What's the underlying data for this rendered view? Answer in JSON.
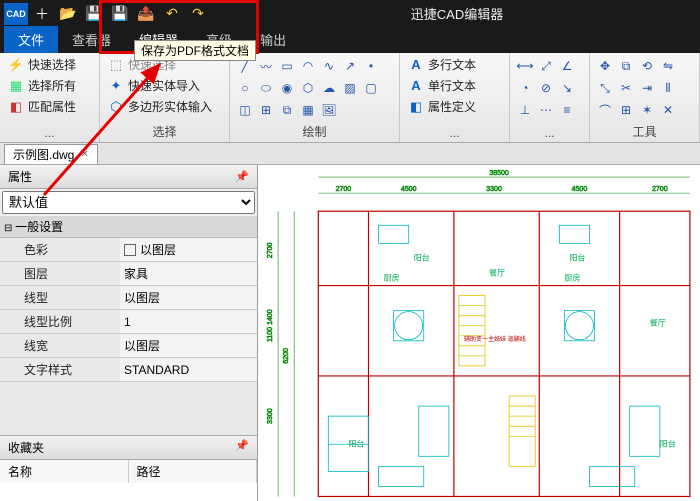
{
  "app": {
    "title": "迅捷CAD编辑器"
  },
  "qat": [
    "CAD",
    "＋",
    "📂",
    "💾",
    "💾",
    "📤",
    "↶",
    "↷"
  ],
  "tabs": {
    "file": "文件",
    "view": "查看器",
    "editor": "编辑器",
    "advanced": "高级",
    "output": "输出"
  },
  "tooltip": "保存为PDF格式文档",
  "ribbon": {
    "quick": {
      "label": "...",
      "quickSelect": "快速选择",
      "selectAll": "选择所有",
      "matchProp": "匹配属性"
    },
    "select": {
      "label": "选择",
      "quickEntityImport": "快速实体导入",
      "polyEntityInput": "多边形实体输入",
      "hint": "快速选择"
    },
    "draw": {
      "label": "绘制"
    },
    "text": {
      "label": "...",
      "mtext": "多行文本",
      "stext": "单行文本",
      "attdef": "属性定义"
    },
    "tools": {
      "label": "工具"
    }
  },
  "fileTab": {
    "name": "示例图.dwg"
  },
  "propPanel": {
    "title": "属性",
    "defaultVal": "默认值",
    "category": "一般设置",
    "rows": [
      {
        "k": "色彩",
        "v": "以图层",
        "swatch": true
      },
      {
        "k": "图层",
        "v": "家具"
      },
      {
        "k": "线型",
        "v": "以图层"
      },
      {
        "k": "线型比例",
        "v": "1"
      },
      {
        "k": "线宽",
        "v": "以图层"
      },
      {
        "k": "文字样式",
        "v": "STANDARD"
      }
    ]
  },
  "fav": {
    "title": "收藏夹",
    "col1": "名称",
    "col2": "路径"
  },
  "floorplan": {
    "totalWidth": "38500",
    "dims": [
      "2700",
      "4500",
      "3300",
      "4500",
      "2700"
    ],
    "rooms": [
      "阳台",
      "厨房",
      "阳台",
      "厨房",
      "餐厅",
      "餐厅",
      "阳台",
      "阳台"
    ],
    "note": "辅助变一主姊妹 迤脯线"
  }
}
